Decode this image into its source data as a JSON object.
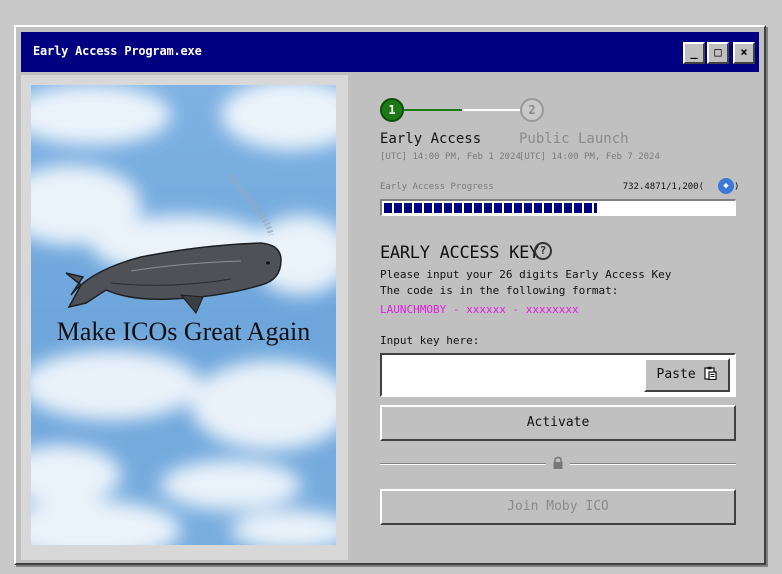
{
  "window": {
    "title": "Early Access Program.exe",
    "controls": {
      "minimize": "_",
      "maximize": "□",
      "close": "×"
    }
  },
  "artwork": {
    "slogan": "Make ICOs Great Again"
  },
  "steps": [
    {
      "number": "1",
      "title": "Early Access",
      "time": "[UTC] 14:00 PM, Feb 1 2024",
      "active": true
    },
    {
      "number": "2",
      "title": "Public Launch",
      "time": "[UTC] 14:00 PM, Feb 7 2024",
      "active": false
    }
  ],
  "progress": {
    "label": "Early Access Progress",
    "value_text": "732.4871/1,200(",
    "value_close": ")",
    "current": 732.4871,
    "total": 1200,
    "icon": "eth-icon"
  },
  "key_section": {
    "title": "EARLY ACCESS KEY",
    "help_glyph": "?",
    "desc_line1": "Please input your 26 digits Early Access Key",
    "desc_line2": "The code is in the following format:",
    "format": "LAUNCHMOBY - xxxxxx - xxxxxxxx",
    "input_label": "Input key here:",
    "input_placeholder": "",
    "paste_label": "Paste"
  },
  "buttons": {
    "activate": "Activate",
    "join": "Join Moby ICO"
  },
  "colors": {
    "titlebar": "#000080",
    "step_active": "#1b7a14",
    "format_text": "#e020e0",
    "progress_fill": "#000080"
  }
}
